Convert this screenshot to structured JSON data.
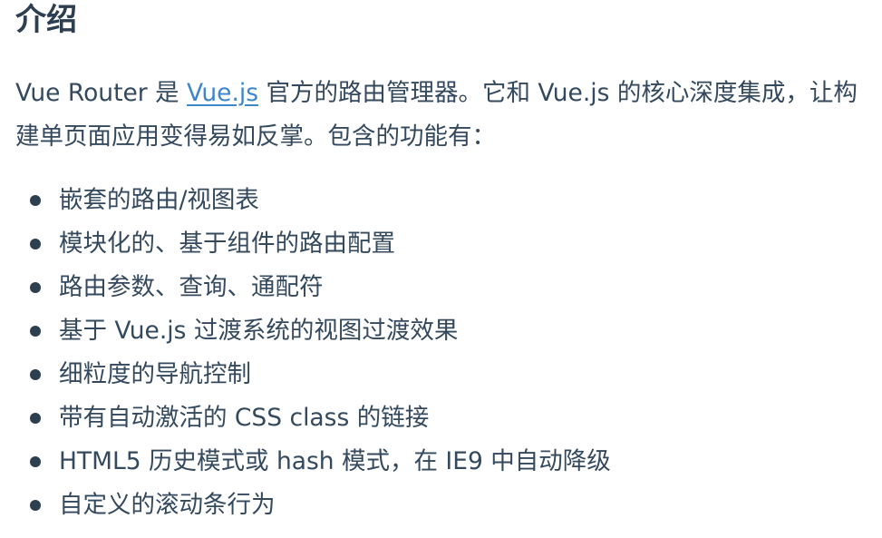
{
  "section": {
    "title": "介绍"
  },
  "intro": {
    "before_link": "Vue Router 是 ",
    "link_text": "Vue.js",
    "after_link": " 官方的路由管理器。它和 Vue.js 的核心深度集成，让构建单页面应用变得易如反掌。包含的功能有："
  },
  "features": [
    "嵌套的路由/视图表",
    "模块化的、基于组件的路由配置",
    "路由参数、查询、通配符",
    "基于 Vue.js 过渡系统的视图过渡效果",
    "细粒度的导航控制",
    "带有自动激活的 CSS class 的链接",
    "HTML5 历史模式或 hash 模式，在 IE9 中自动降级",
    "自定义的滚动条行为"
  ],
  "colors": {
    "link": "#3f86c9",
    "heading": "#2c3e50",
    "text": "#34495e"
  }
}
